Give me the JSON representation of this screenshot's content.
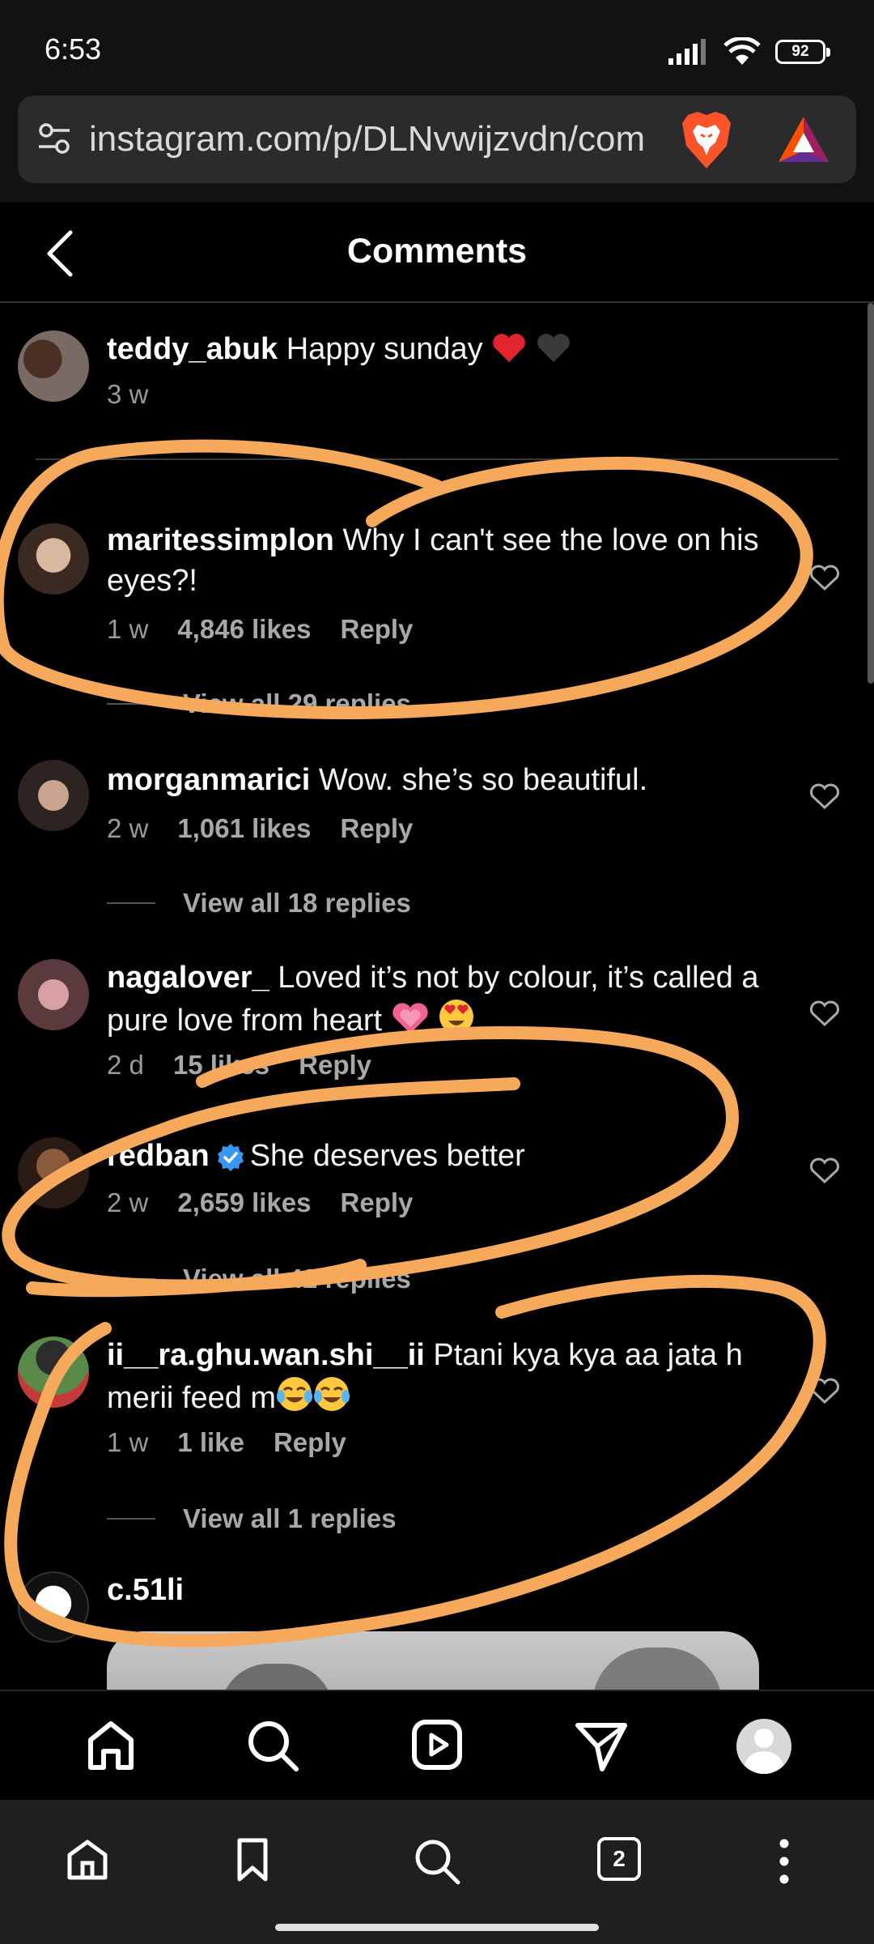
{
  "status": {
    "time": "6:53",
    "battery": "92"
  },
  "browser": {
    "url": "instagram.com/p/DLNvwijzvdn/com"
  },
  "header": {
    "title": "Comments"
  },
  "comments": [
    {
      "username": "teddy_abuk",
      "text": "Happy sunday",
      "time": "3 w"
    },
    {
      "username": "maritessimplon",
      "text": "Why I can't see the love on his eyes?!",
      "time": "1 w",
      "likes": "4,846 likes",
      "reply": "Reply",
      "view_replies": "View all 29 replies"
    },
    {
      "username": "morganmarici",
      "text": "Wow. she’s so beautiful.",
      "time": "2 w",
      "likes": "1,061 likes",
      "reply": "Reply",
      "view_replies": "View all 18 replies"
    },
    {
      "username": "nagalover_",
      "text": "Loved it’s not by colour, it’s called a pure love from heart",
      "time": "2 d",
      "likes": "15 likes",
      "reply": "Reply"
    },
    {
      "username": "redban",
      "text": "She deserves better",
      "time": "2 w",
      "likes": "2,659 likes",
      "reply": "Reply",
      "view_replies": "View all 42 replies",
      "verified": true
    },
    {
      "username": "ii__ra.ghu.wan.shi__ii",
      "text": "Ptani kya kya aa jata h merii feed m",
      "time": "1 w",
      "likes": "1 like",
      "reply": "Reply",
      "view_replies": "View all 1 replies"
    },
    {
      "username": "c.51li"
    }
  ],
  "ig_nav": [
    "home-icon",
    "search-icon",
    "reels-icon",
    "direct-icon",
    "profile-avatar"
  ],
  "browser_nav": {
    "tabs_count": "2"
  },
  "colors": {
    "annotation": "#F6A95B",
    "verified": "#3897F0",
    "heart_red": "#E0262C"
  }
}
